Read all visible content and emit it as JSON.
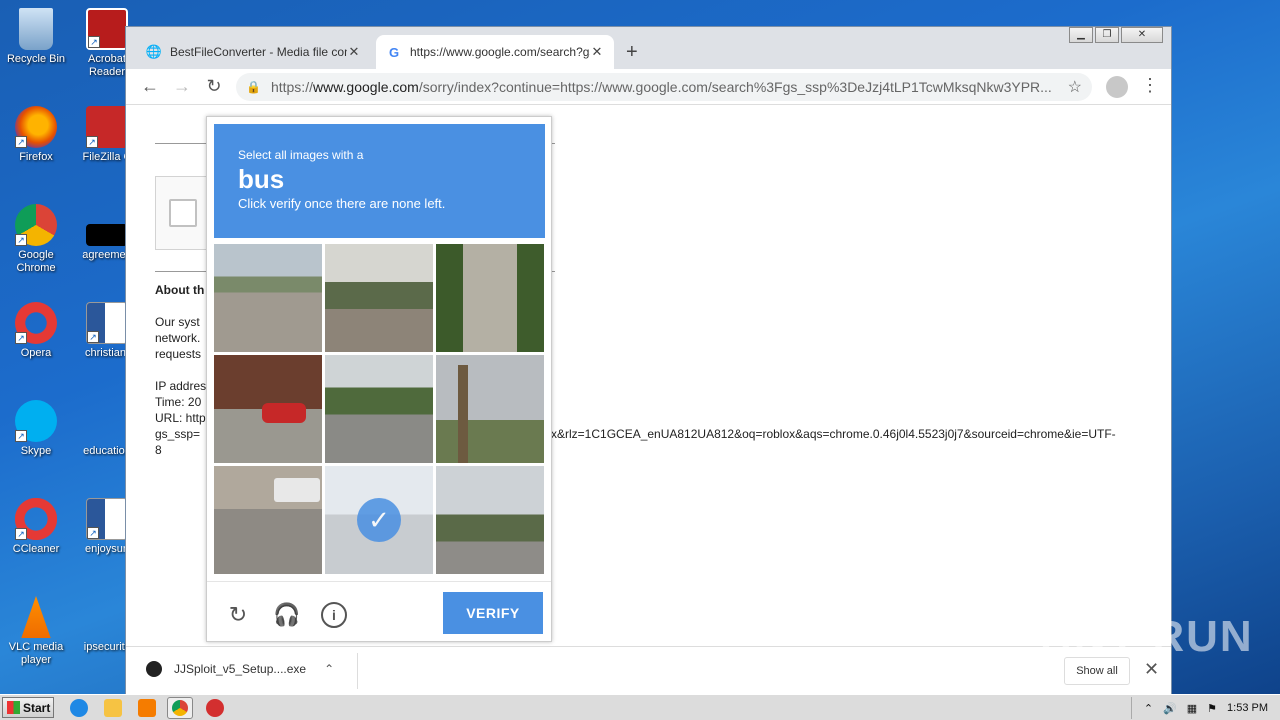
{
  "desktop": {
    "icons": [
      {
        "label": "Recycle Bin"
      },
      {
        "label": "Acrobat Reader"
      },
      {
        "label": "Firefox"
      },
      {
        "label": "FileZilla C"
      },
      {
        "label": "Google Chrome"
      },
      {
        "label": "agreemen"
      },
      {
        "label": "Opera"
      },
      {
        "label": "christianf"
      },
      {
        "label": "Skype"
      },
      {
        "label": "education"
      },
      {
        "label": "CCleaner"
      },
      {
        "label": "enjoysun"
      },
      {
        "label": "VLC media player"
      },
      {
        "label": "ipsecurity"
      }
    ]
  },
  "browser": {
    "tabs": [
      {
        "title": "BestFileConverter - Media file conver"
      },
      {
        "title": "https://www.google.com/search?gs_"
      }
    ],
    "omnibox": {
      "url_prefix": "https://",
      "url_host": "www.google.com",
      "url_rest": "/sorry/index?continue=https://www.google.com/search%3Fgs_ssp%3DeJzj4tLP1TcwMksqNkw3YPR..."
    }
  },
  "page": {
    "about_heading": "About th",
    "para1": [
      "Our syst",
      "network.",
      "requests"
    ],
    "ip_line": "IP addres",
    "time_line": "Time: 20",
    "url_line": "URL: http",
    "gs_line": "gs_ssp=",
    "url_tail": "x&rlz=1C1GCEA_enUA812UA812&oq=roblox&aqs=chrome.0.46j0l4.5523j0j7&sourceid=chrome&ie=UTF-",
    "url_tail2": "8"
  },
  "captcha": {
    "instruction_small": "Select all images with a",
    "target": "bus",
    "instruction_sub": "Click verify once there are none left.",
    "verify_label": "VERIFY"
  },
  "download_bar": {
    "filename": "JJSploit_v5_Setup....exe",
    "show_all": "Show all"
  },
  "taskbar": {
    "start_label": "Start",
    "clock": "1:53 PM"
  },
  "watermark": "ANY RUN",
  "colors": {
    "captcha_blue": "#4a90e2",
    "tab_bar": "#dee1e6"
  }
}
